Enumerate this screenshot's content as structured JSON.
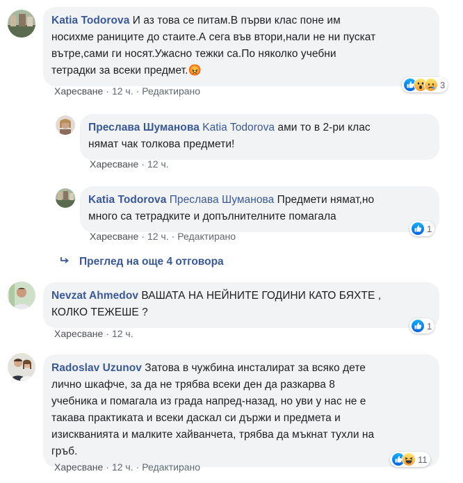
{
  "comments": [
    {
      "author": "Katia Todorova",
      "text_lines": [
        "И аз това се питам.В първи клас поне им",
        "носихме раниците до стаите.А сега във втори,нали не ни пускат",
        "вътре,сами ги носят.Ужасно тежки са.По няколко учебни",
        "тетрадки за всеки предмет.😡"
      ],
      "like": "Харесване",
      "time": "12 ч.",
      "edited": "Редактирано",
      "reactions": [
        "like-icon",
        "wow-icon",
        "sad-icon"
      ],
      "reaction_count": "3"
    },
    {
      "author": "Преслава Шуманова",
      "mention": "Katia Todorova",
      "text_first": " ами то в 2-ри клас",
      "text_line2": "нямат чак толкова предмети!",
      "like": "Харесване",
      "time": "12 ч."
    },
    {
      "author": "Katia Todorova",
      "mention": "Преслава Шуманова",
      "text_first": " Предмети нямат,но",
      "text_line2": "много са тетрадките и допълнителните помагала",
      "like": "Харесване",
      "time": "12 ч.",
      "edited": "Редактирано",
      "reactions": [
        "like-icon"
      ],
      "reaction_count": "1"
    },
    {
      "author": "Nevzat Ahmedov",
      "text_first": " ВАШАТА НА НЕЙНИТЕ ГОДИНИ КАТО БЯХТЕ ,",
      "text_line2": "КОЛКО ТЕЖЕШЕ ?",
      "like": "Харесване",
      "time": "12 ч.",
      "reactions": [
        "like-icon"
      ],
      "reaction_count": "1"
    },
    {
      "author": "Radoslav Uzunov",
      "text_first": " Затова в чужбина инсталират за всяко дете",
      "text_lines": [
        "лично шкафче, за да не трябва всеки ден да разкарва 8",
        "учебника и помагала из града напред-назад, но уви у нас не е",
        "такава практиката и всеки даскал си държи и предмета и",
        "изискванията и малките хайванчета, трябва да мъкнат тухли на",
        "гръб."
      ],
      "like": "Харесване",
      "time": "12 ч.",
      "edited": "Редактирано",
      "reactions": [
        "like-icon",
        "haha-icon"
      ],
      "reaction_count": "11"
    }
  ],
  "more_replies": "Преглед на още 4 отговора",
  "colors": {
    "link": "#385898",
    "bubble": "#f2f3f5",
    "meta": "#606770",
    "like": "#1877f2"
  }
}
